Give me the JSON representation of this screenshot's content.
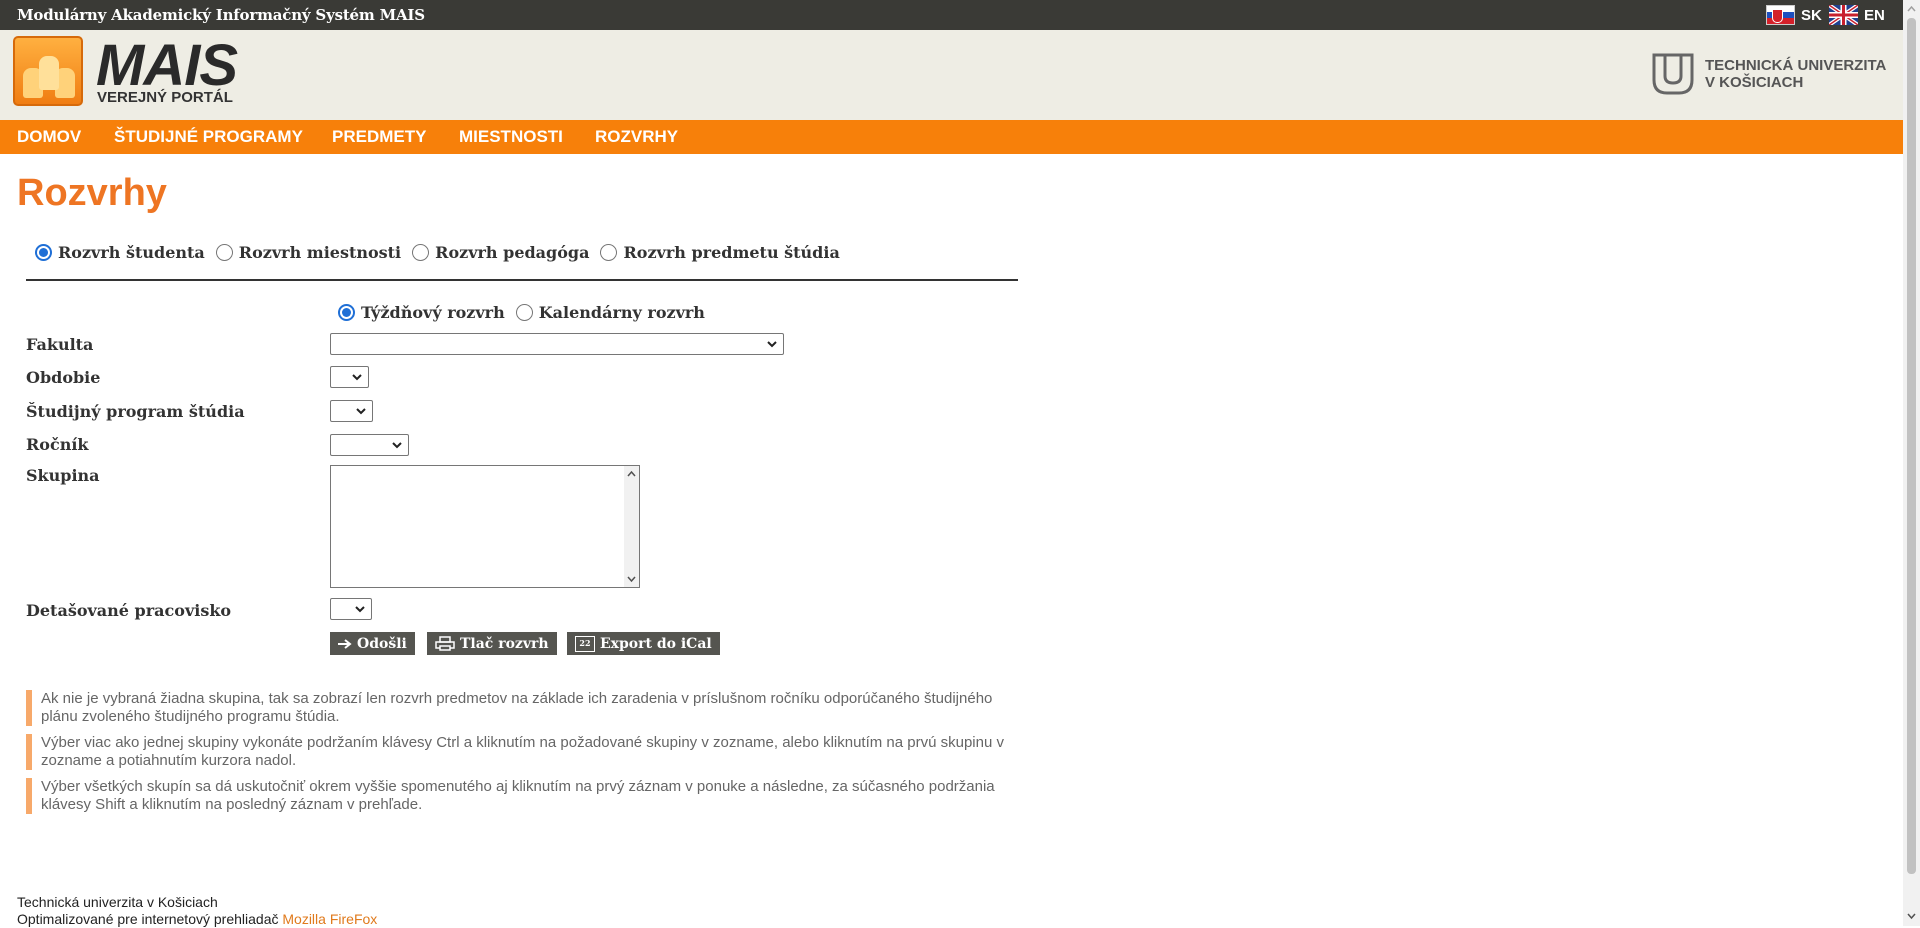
{
  "topbar": {
    "title": "Modulárny Akademický Informačný Systém MAIS",
    "lang_sk": "SK",
    "lang_en": "EN"
  },
  "header": {
    "logo_word": "MAIS",
    "portal_label": "VEREJNÝ PORTÁL",
    "university_line1": "TECHNICKÁ UNIVERZITA",
    "university_line2": "V KOŠICIACH"
  },
  "nav": {
    "items": [
      "DOMOV",
      "ŠTUDIJNÉ PROGRAMY",
      "PREDMETY",
      "MIESTNOSTI",
      "ROZVRHY"
    ]
  },
  "main": {
    "title": "Rozvrhy",
    "schedule_types": [
      {
        "label": "Rozvrh študenta",
        "checked": true
      },
      {
        "label": "Rozvrh miestnosti",
        "checked": false
      },
      {
        "label": "Rozvrh pedagóga",
        "checked": false
      },
      {
        "label": "Rozvrh predmetu štúdia",
        "checked": false
      }
    ],
    "view_types": [
      {
        "label": "Týždňový rozvrh",
        "checked": true
      },
      {
        "label": "Kalendárny rozvrh",
        "checked": false
      }
    ],
    "fields": {
      "fakulta": "Fakulta",
      "obdobie": "Obdobie",
      "program": "Študijný program štúdia",
      "rocnik": "Ročník",
      "skupina": "Skupina",
      "detasovane": "Detašované pracovisko"
    },
    "values": {
      "fakulta": "",
      "obdobie": "",
      "program": "",
      "rocnik": "",
      "detasovane": ""
    },
    "buttons": {
      "send": "Odošli",
      "print": "Tlač rozvrh",
      "ical": "Export do iCal",
      "ical_icon_text": "22"
    },
    "notes": [
      "Ak nie je vybraná žiadna skupina, tak sa zobrazí len rozvrh predmetov na základe ich zaradenia v príslušnom ročníku odporúčaného študijného plánu zvoleného študijného programu štúdia.",
      "Výber viac ako jednej skupiny vykonáte podržaním klávesy Ctrl a kliknutím na požadované skupiny v zozname, alebo kliknutím na prvú skupinu v zozname a potiahnutím kurzora nadol.",
      "Výber všetkých skupín sa dá uskutočniť okrem vyššie spomenutého aj kliknutím na prvý záznam v ponuke a následne, za súčasného podržania klávesy Shift a kliknutím na posledný záznam v prehľade."
    ]
  },
  "footer": {
    "line1": "Technická univerzita v Košiciach",
    "line2_prefix": "Optimalizované pre internetový prehliadač ",
    "browser_link": "Mozilla FireFox"
  },
  "colors": {
    "accent": "#f7800a",
    "title": "#ee7523",
    "topbar": "#3a3a36",
    "header_bg": "#eeede4",
    "note_border": "#f7a96a",
    "button_bg": "#555550"
  }
}
